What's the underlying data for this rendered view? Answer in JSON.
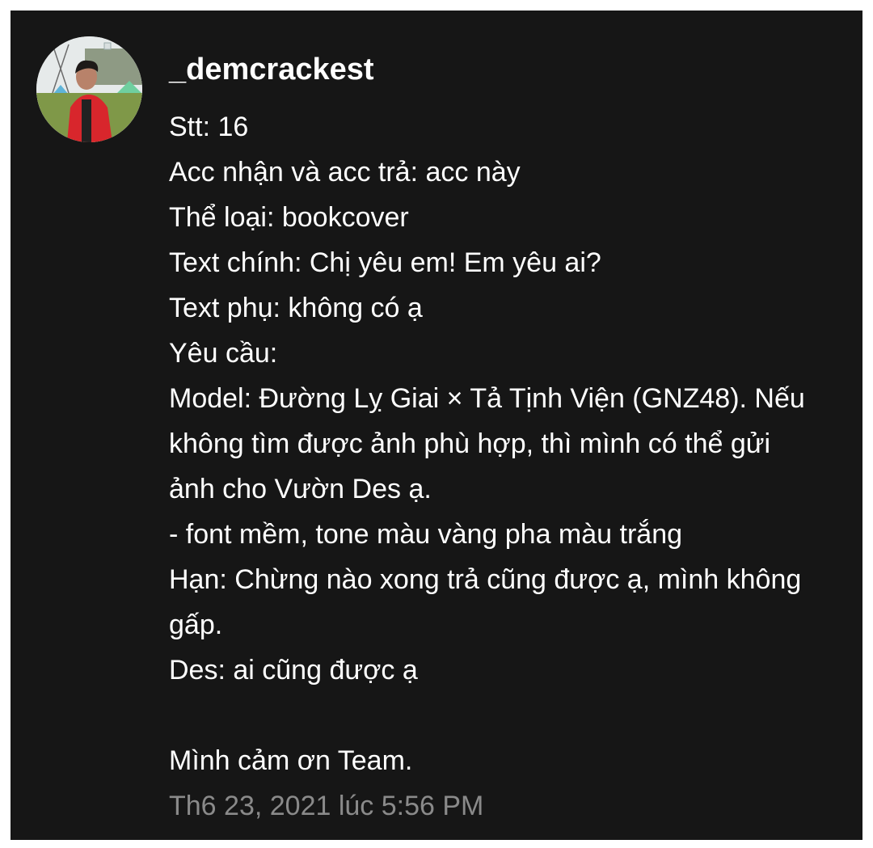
{
  "post": {
    "username": "_demcrackest",
    "avatar_icon": "profile-photo",
    "lines": [
      "Stt: 16",
      "Acc nhận và acc trả: acc này",
      "Thể loại: bookcover",
      "Text chính: Chị yêu em! Em yêu ai?",
      "Text phụ: không có ạ",
      "Yêu cầu:",
      "Model: Đường Lỵ Giai × Tả Tịnh Viện (GNZ48). Nếu",
      "không tìm được ảnh phù hợp, thì mình có thể gửi",
      "ảnh cho Vườn Des ạ.",
      "- font mềm, tone màu vàng pha màu trắng",
      "Hạn: Chừng nào xong trả cũng được ạ, mình không",
      "gấp.",
      "Des: ai cũng được ạ",
      "",
      "Mình cảm ơn Team."
    ],
    "timestamp": "Th6 23, 2021 lúc 5:56 PM"
  },
  "colors": {
    "card_background": "#161616",
    "text": "#ffffff",
    "timestamp": "#8a8a8a"
  }
}
